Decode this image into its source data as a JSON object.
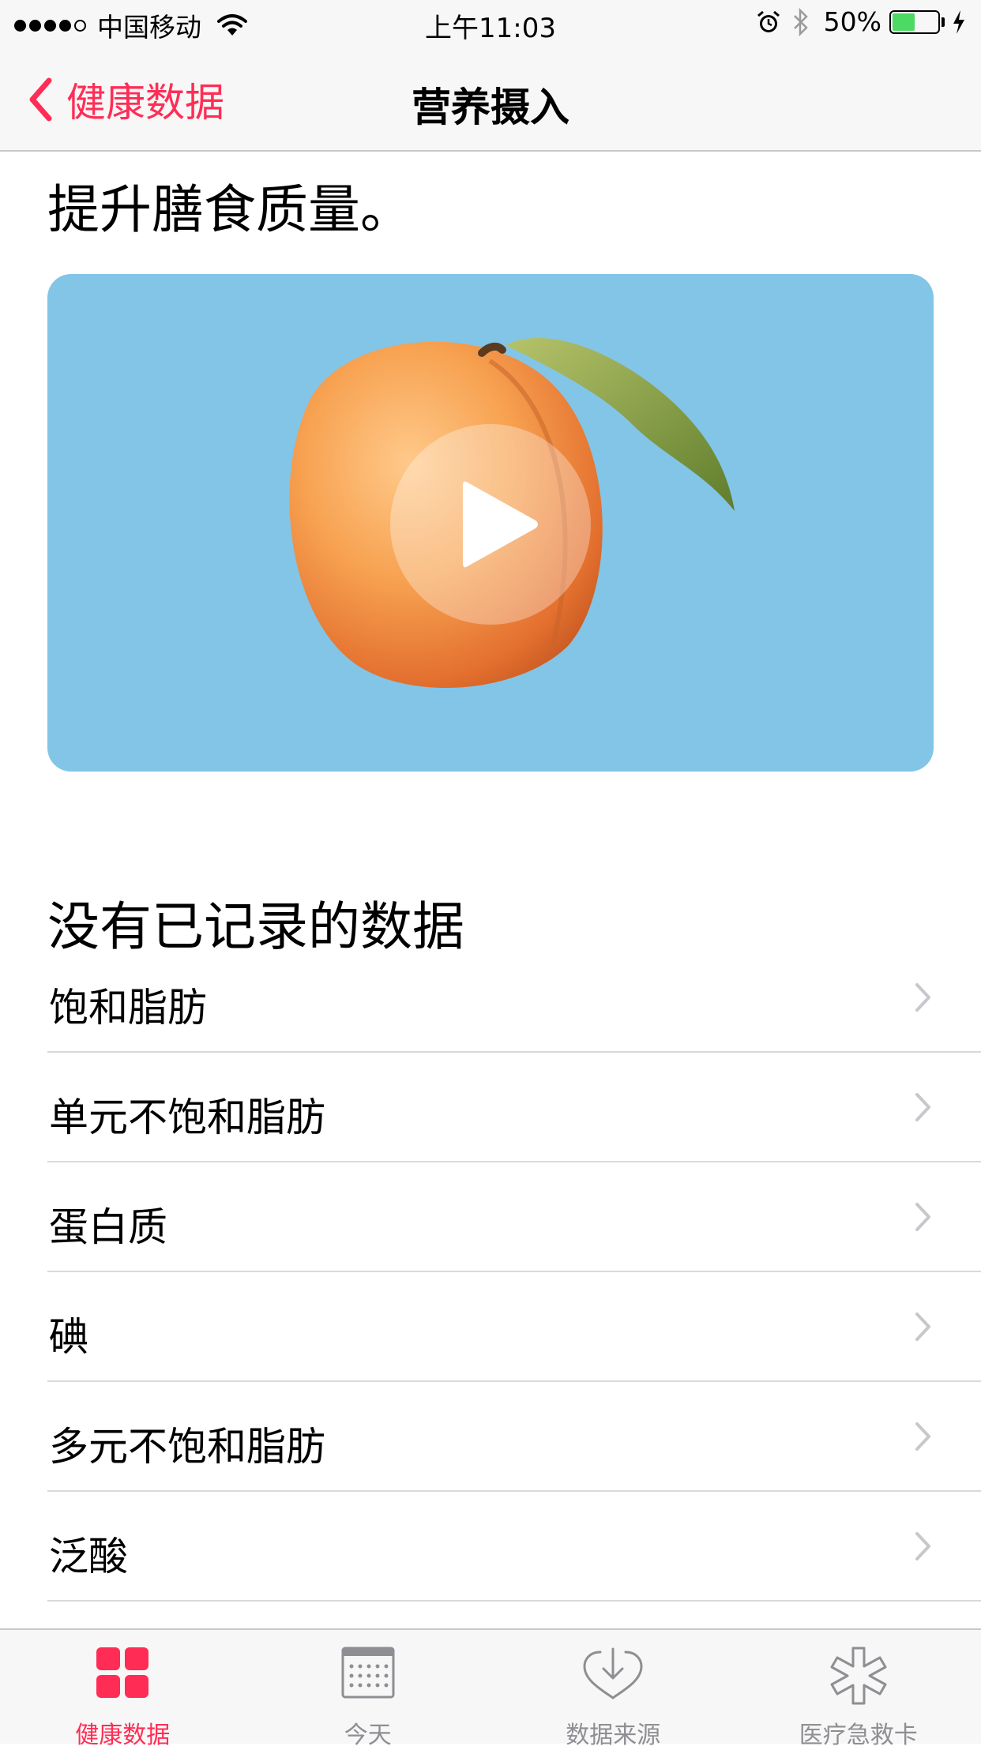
{
  "status_bar": {
    "carrier": "中国移动",
    "time": "上午11:03",
    "battery_percent": "50%",
    "battery_level": 0.5,
    "signal_bars_filled": 4,
    "signal_bars_total": 5
  },
  "nav": {
    "back_label": "健康数据",
    "title": "营养摄入"
  },
  "intro": {
    "text": "提升膳食质量。"
  },
  "video": {
    "background_color": "#82c5e7",
    "play_icon": "play-icon"
  },
  "section": {
    "header": "没有已记录的数据"
  },
  "list": {
    "items": [
      {
        "label": "饱和脂肪"
      },
      {
        "label": "单元不饱和脂肪"
      },
      {
        "label": "蛋白质"
      },
      {
        "label": "碘"
      },
      {
        "label": "多元不饱和脂肪"
      },
      {
        "label": "泛酸"
      }
    ]
  },
  "tabs": [
    {
      "label": "健康数据",
      "icon": "grid-icon",
      "active": true
    },
    {
      "label": "今天",
      "icon": "calendar-icon",
      "active": false
    },
    {
      "label": "数据来源",
      "icon": "download-heart-icon",
      "active": false
    },
    {
      "label": "医疗急救卡",
      "icon": "medical-asterisk-icon",
      "active": false
    }
  ],
  "colors": {
    "accent": "#ff2d55",
    "tab_inactive": "#8e8e93",
    "battery_fill": "#4cd964",
    "separator": "#d9d9dd"
  }
}
